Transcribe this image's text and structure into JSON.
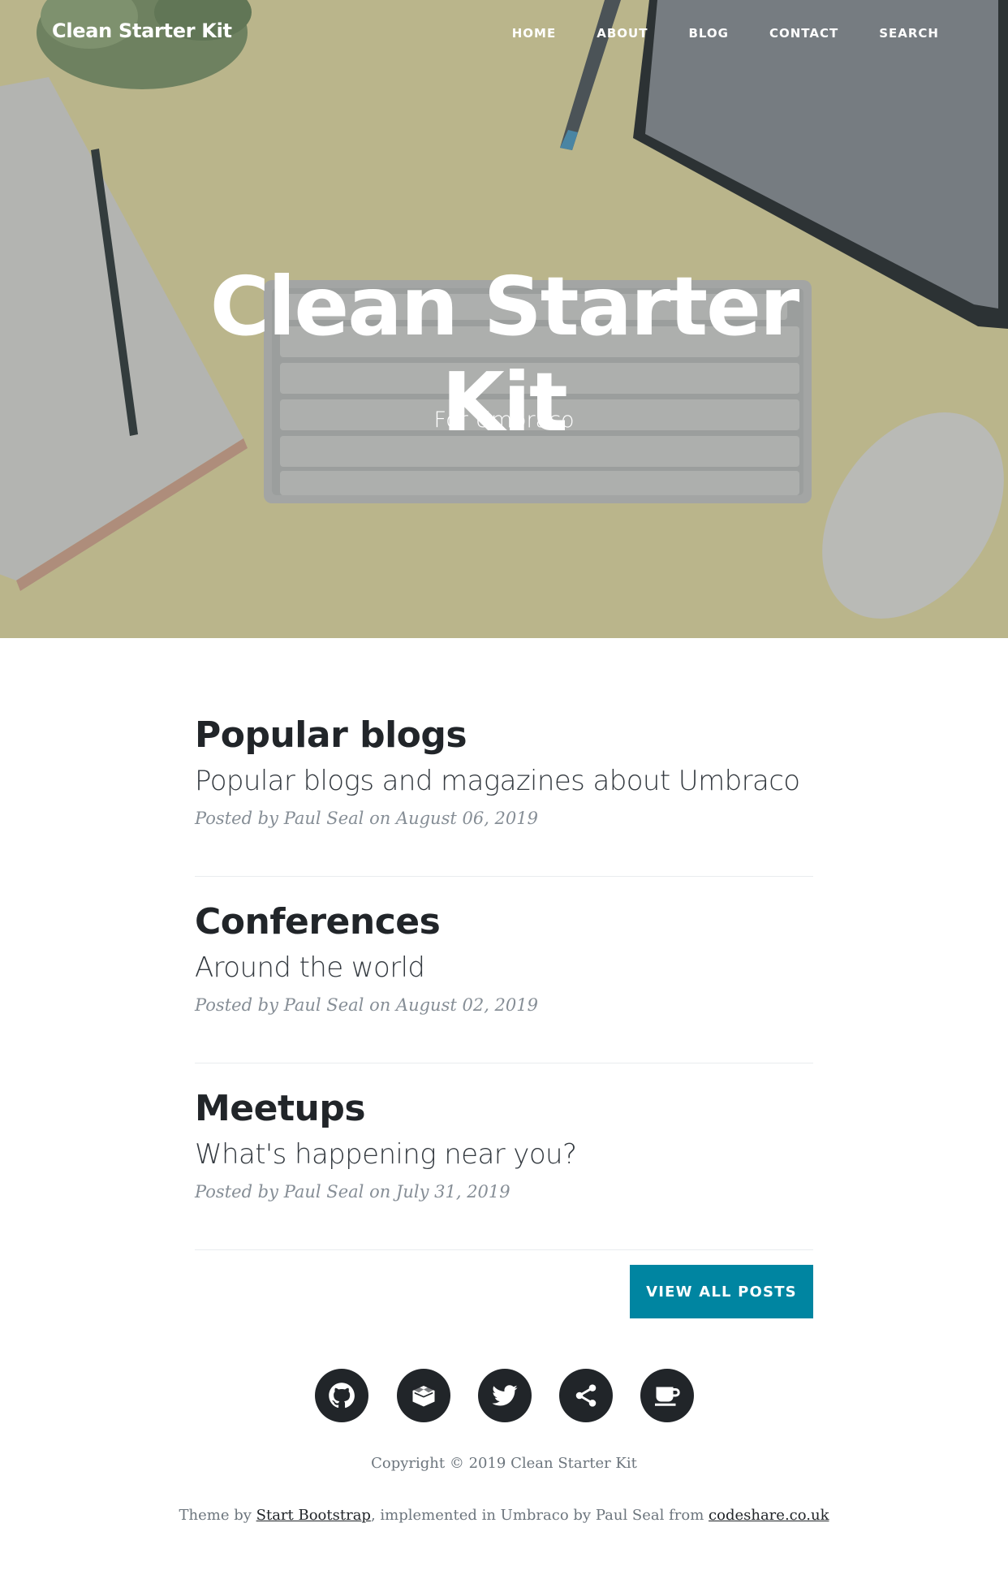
{
  "nav": {
    "brand": "Clean Starter Kit",
    "links": [
      "HOME",
      "ABOUT",
      "BLOG",
      "CONTACT",
      "SEARCH"
    ]
  },
  "hero": {
    "title_line1": "Clean Starter",
    "title_line2": "Kit",
    "subtitle": "For Umbraco"
  },
  "posts": [
    {
      "title": "Popular blogs",
      "subtitle": "Popular blogs and magazines about Umbraco",
      "meta_prefix": "Posted by",
      "author": "Paul Seal",
      "meta_on": "on",
      "date": "August 06, 2019"
    },
    {
      "title": "Conferences",
      "subtitle": "Around the world",
      "meta_prefix": "Posted by",
      "author": "Paul Seal",
      "meta_on": "on",
      "date": "August 02, 2019"
    },
    {
      "title": "Meetups",
      "subtitle": "What's happening near you?",
      "meta_prefix": "Posted by",
      "author": "Paul Seal",
      "meta_on": "on",
      "date": "July 31, 2019"
    }
  ],
  "view_all_label": "VIEW ALL POSTS",
  "social_icons": [
    "github-icon",
    "package-icon",
    "twitter-icon",
    "share-icon",
    "coffee-cup-icon"
  ],
  "footer": {
    "copyright": "Copyright © 2019 Clean Starter Kit",
    "credits_prefix": "Theme by",
    "credits_link1": "Start Bootstrap",
    "credits_middle": ", implemented in Umbraco by Paul Seal from",
    "credits_link2": "codeshare.co.uk"
  },
  "colors": {
    "accent": "#0085a1",
    "text_dark": "#212529",
    "meta_gray": "#868e96"
  }
}
